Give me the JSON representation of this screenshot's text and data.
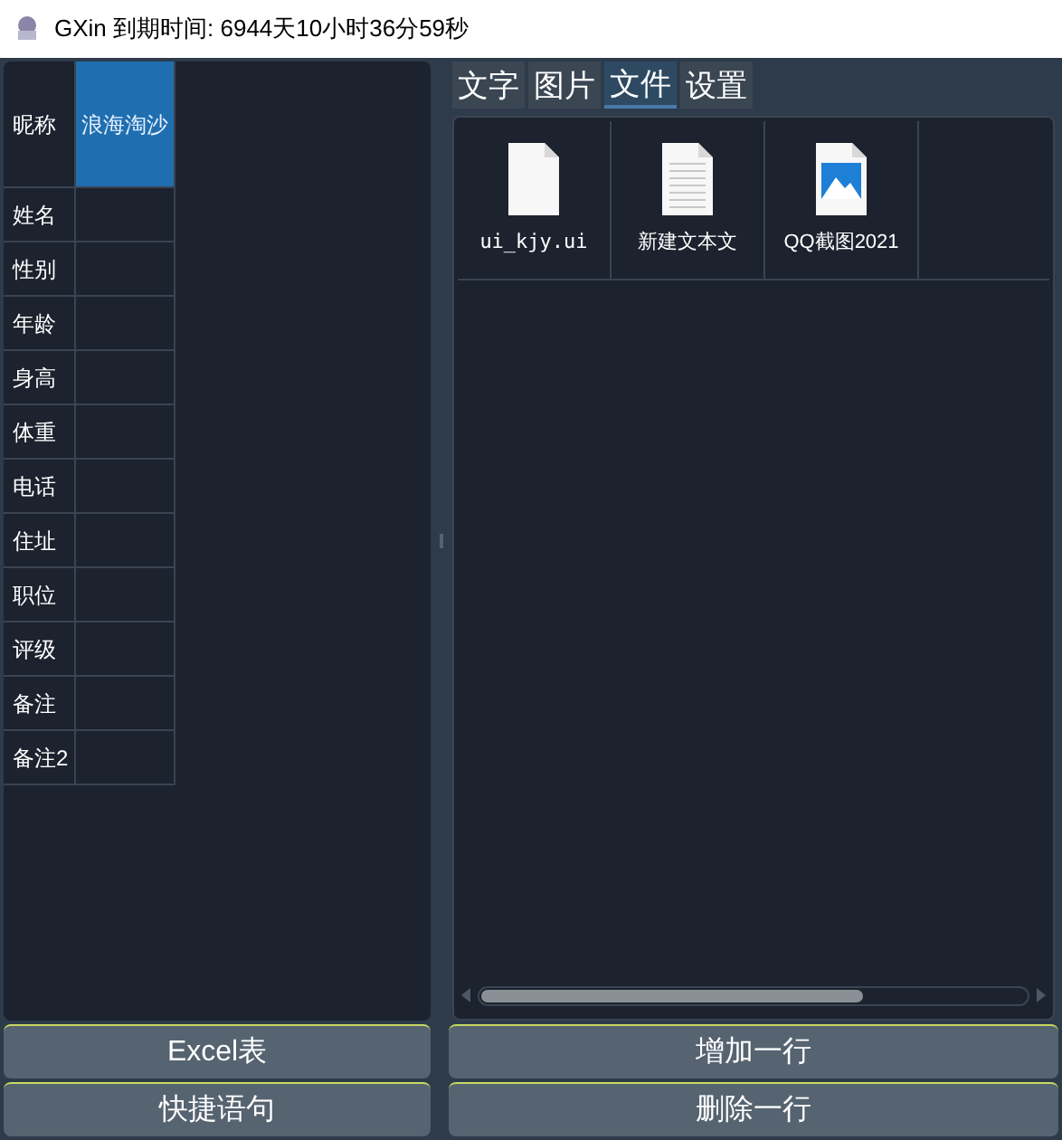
{
  "window": {
    "title": "GXin 到期时间: 6944天10小时36分59秒"
  },
  "profile": [
    {
      "label": "昵称",
      "value": "浪海淘沙",
      "selected": true
    },
    {
      "label": "姓名",
      "selected": false
    },
    {
      "label": "性别",
      "selected": false
    },
    {
      "label": "年龄",
      "selected": false
    },
    {
      "label": "身高",
      "selected": false
    },
    {
      "label": "体重",
      "selected": false
    },
    {
      "label": "电话",
      "selected": false
    },
    {
      "label": "住址",
      "selected": false
    },
    {
      "label": "职位",
      "selected": false
    },
    {
      "label": "评级",
      "selected": false
    },
    {
      "label": "备注",
      "selected": false
    },
    {
      "label": "备注2",
      "selected": false
    }
  ],
  "tabs": [
    {
      "label": "文字",
      "selected": false
    },
    {
      "label": "图片",
      "selected": false
    },
    {
      "label": "文件",
      "selected": true
    },
    {
      "label": "设置",
      "selected": false
    }
  ],
  "files": [
    {
      "name": "ui_kjy.ui",
      "kind": "blank"
    },
    {
      "name": "新建文本文",
      "kind": "text"
    },
    {
      "name": "QQ截图2021",
      "kind": "image"
    }
  ],
  "left_buttons": [
    "Excel表",
    "快捷语句"
  ],
  "right_buttons": [
    "增加一行",
    "删除一行"
  ]
}
